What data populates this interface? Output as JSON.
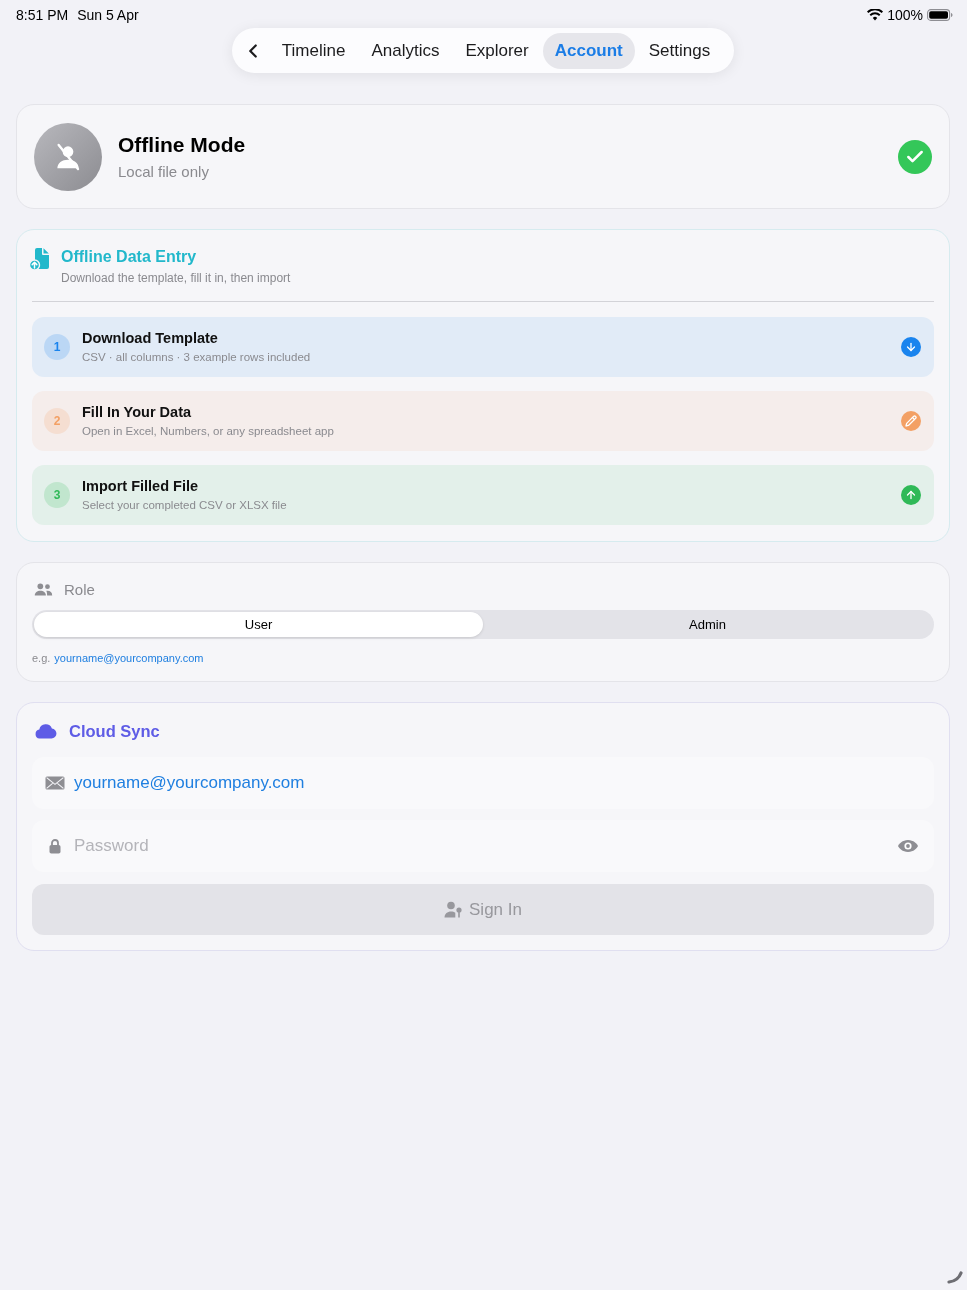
{
  "status_bar": {
    "time": "8:51 PM",
    "date": "Sun 5 Apr",
    "battery": "100%"
  },
  "nav": {
    "tabs": [
      {
        "label": "Timeline",
        "selected": false
      },
      {
        "label": "Analytics",
        "selected": false
      },
      {
        "label": "Explorer",
        "selected": false
      },
      {
        "label": "Account",
        "selected": true
      },
      {
        "label": "Settings",
        "selected": false
      }
    ]
  },
  "profile": {
    "title": "Offline Mode",
    "subtitle": "Local file only",
    "verified": true
  },
  "data_entry": {
    "title": "Offline Data Entry",
    "subtitle": "Download the template, fill it in, then import",
    "steps": [
      {
        "number": "1",
        "title": "Download Template",
        "subtitle": "CSV · all columns · 3 example rows included",
        "kind": "download",
        "color": "#1a84ee"
      },
      {
        "number": "2",
        "title": "Fill In Your Data",
        "subtitle": "Open in Excel, Numbers, or any spreadsheet app",
        "kind": "edit",
        "color": "#f3a064"
      },
      {
        "number": "3",
        "title": "Import Filled File",
        "subtitle": "Select your completed CSV or XLSX file",
        "kind": "upload",
        "color": "#2fb957"
      }
    ]
  },
  "role": {
    "label": "Role",
    "options": [
      {
        "label": "User",
        "selected": true
      },
      {
        "label": "Admin",
        "selected": false
      }
    ],
    "hint": "e.g.",
    "hint_link": "yourname@yourcompany.com"
  },
  "cloud_sync": {
    "title": "Cloud Sync",
    "email": {
      "value": "yourname@yourcompany.com"
    },
    "password": {
      "placeholder": "Password"
    },
    "sign_in": {
      "label": "Sign In",
      "disabled": true
    }
  }
}
